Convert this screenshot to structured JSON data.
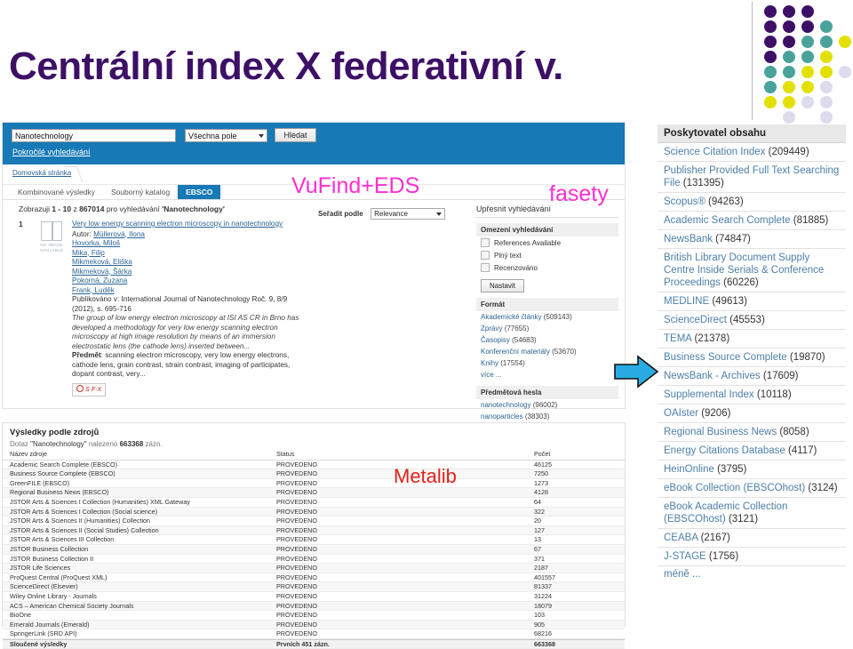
{
  "slide": {
    "title": "Centrální index X federativní v."
  },
  "decor": {
    "name": "dot-grid",
    "colors": {
      "purple": "#3d1066",
      "teal": "#49a39b",
      "yellow": "#e3e000",
      "lavender": "#dcdcec"
    },
    "rows": [
      [
        "purple",
        "purple",
        "purple",
        "",
        ""
      ],
      [
        "purple",
        "purple",
        "purple",
        "teal",
        ""
      ],
      [
        "purple",
        "purple",
        "teal",
        "teal",
        "yellow"
      ],
      [
        "purple",
        "teal",
        "teal",
        "yellow",
        ""
      ],
      [
        "teal",
        "teal",
        "yellow",
        "yellow",
        "lavender"
      ],
      [
        "teal",
        "yellow",
        "yellow",
        "lavender",
        ""
      ],
      [
        "yellow",
        "yellow",
        "lavender",
        "lavender",
        ""
      ],
      [
        "",
        "lavender",
        "",
        "lavender",
        ""
      ]
    ]
  },
  "annotations": {
    "vufind": "VuFind+EDS",
    "fasety": "fasety",
    "metalib": "Metalib",
    "arrow_color": "#29abe2",
    "pink": "#ff2fd0",
    "red": "#e32119"
  },
  "vufind": {
    "search": {
      "query_value": "Nanotechnology",
      "scope_value": "Všechna pole",
      "submit_label": "Hledat",
      "advanced_link": "Pokročilé vyhledávání"
    },
    "breadcrumb": "Domovská stránka",
    "tabs": [
      {
        "label": "Kombinované výsledky",
        "active": false
      },
      {
        "label": "Souborný katalog",
        "active": false
      },
      {
        "label": "EBSCO",
        "active": true
      }
    ],
    "results_summary": {
      "prefix": "Zobrazuji",
      "range": "1 - 10",
      "of": "z",
      "total": "867014",
      "suffix": "pro vyhledávání",
      "query": "'Nanotechnology'"
    },
    "sort": {
      "label": "Seřadit podle",
      "value": "Relevance"
    },
    "record": {
      "number": "1",
      "no_image": "NO IMAGE AVAILABLE",
      "title": "Very low energy scanning electron microscopy in nanotechnology",
      "author_label": "Autor:",
      "authors": [
        "Müllerová, Ilona",
        "Hovorka, Miloš",
        "Mika, Filip",
        "Mikmeková, Eliška",
        "Mikmeková, Šárka",
        "Pokorná, Zuzana",
        "Frank, Luděk"
      ],
      "published": "Publikováno v: International Journal of Nanotechnology Roč. 9, 8/9 (2012), s. 695-716",
      "abstract": "The group of low energy electron microscopy at ISI AS CR in Brno has developed a methodology for very low energy scanning electron microscopy at high image resolution by means of an immersion electrostatic lens (the cathode lens) inserted between...",
      "subject_label": "Předmět",
      "subject": ": scanning electron microscopy, very low energy electrons, cathode lens, grain contrast, strain contrast, imaging of participates, dopant contrast, very...",
      "sfx_label": "S·F·X"
    },
    "facets": {
      "title": "Upřesnit vyhledávání",
      "limit_group": {
        "header": "Omezení vyhledávání",
        "items": [
          "References Available",
          "Plný text",
          "Recenzováno"
        ],
        "button": "Nastavit"
      },
      "format_group": {
        "header": "Formát",
        "items": [
          {
            "label": "Akademické články",
            "count": "(509143)"
          },
          {
            "label": "Zprávy",
            "count": "(77655)"
          },
          {
            "label": "Časopisy",
            "count": "(54683)"
          },
          {
            "label": "Konferenční materiály",
            "count": "(53670)"
          },
          {
            "label": "Knihy",
            "count": "(17554)"
          }
        ],
        "more": "více ..."
      },
      "subject_group": {
        "header": "Předmětová hesla",
        "items": [
          {
            "label": "nanotechnology",
            "count": "(96002)"
          },
          {
            "label": "nanoparticles",
            "count": "(38303)"
          }
        ]
      }
    }
  },
  "provider_panel": {
    "header": "Poskytovatel obsahu",
    "items": [
      {
        "label": "Science Citation Index",
        "count": "(209449)"
      },
      {
        "label": "Publisher Provided Full Text Searching File",
        "count": "(131395)"
      },
      {
        "label": "Scopus®",
        "count": "(94263)"
      },
      {
        "label": "Academic Search Complete",
        "count": "(81885)"
      },
      {
        "label": "NewsBank",
        "count": "(74847)"
      },
      {
        "label": "British Library Document Supply Centre Inside Serials & Conference Proceedings",
        "count": "(60226)"
      },
      {
        "label": "MEDLINE",
        "count": "(49613)"
      },
      {
        "label": "ScienceDirect",
        "count": "(45553)"
      },
      {
        "label": "TEMA",
        "count": "(21378)"
      },
      {
        "label": "Business Source Complete",
        "count": "(19870)"
      },
      {
        "label": "NewsBank - Archives",
        "count": "(17609)"
      },
      {
        "label": "Supplemental Index",
        "count": "(10118)"
      },
      {
        "label": "OAIster",
        "count": "(9206)"
      },
      {
        "label": "Regional Business News",
        "count": "(8058)"
      },
      {
        "label": "Energy Citations Database",
        "count": "(4117)"
      },
      {
        "label": "HeinOnline",
        "count": "(3795)"
      },
      {
        "label": "eBook Collection (EBSCOhost)",
        "count": "(3124)"
      },
      {
        "label": "eBook Academic Collection (EBSCOhost)",
        "count": "(3121)"
      },
      {
        "label": "CEABA",
        "count": "(2167)"
      },
      {
        "label": "J-STAGE",
        "count": "(1756)"
      }
    ],
    "less": "méně ..."
  },
  "metalib": {
    "title": "Výsledky podle zdrojů",
    "subtitle_prefix": "Dotaz",
    "subtitle_query": "\"Nanotechnology\"",
    "subtitle_mid": "nalezeno",
    "subtitle_total": "663368",
    "subtitle_suffix": "zázn.",
    "columns": [
      "Název zdroje",
      "Status",
      "Počet"
    ],
    "rows": [
      {
        "source": "Academic Search Complete (EBSCO)",
        "status": "PROVEDENO",
        "count": "46125"
      },
      {
        "source": "Business Source Complete (EBSCO)",
        "status": "PROVEDENO",
        "count": "7250"
      },
      {
        "source": "GreenFILE (EBSCO)",
        "status": "PROVEDENO",
        "count": "1273"
      },
      {
        "source": "Regional Business News (EBSCO)",
        "status": "PROVEDENO",
        "count": "4128"
      },
      {
        "source": "JSTOR Arts & Sciences I Collection (Humanities) XML Gateway",
        "status": "PROVEDENO",
        "count": "64"
      },
      {
        "source": "JSTOR Arts & Sciences I Collection (Social science)",
        "status": "PROVEDENO",
        "count": "322"
      },
      {
        "source": "JSTOR Arts & Sciences II (Humanities) Collection",
        "status": "PROVEDENO",
        "count": "20"
      },
      {
        "source": "JSTOR Arts & Sciences II (Social Studies) Collection",
        "status": "PROVEDENO",
        "count": "127"
      },
      {
        "source": "JSTOR Arts & Sciences III Collection",
        "status": "PROVEDENO",
        "count": "13"
      },
      {
        "source": "JSTOR Business Collection",
        "status": "PROVEDENO",
        "count": "67"
      },
      {
        "source": "JSTOR Business Collection II",
        "status": "PROVEDENO",
        "count": "371"
      },
      {
        "source": "JSTOR Life Sciences",
        "status": "PROVEDENO",
        "count": "2187"
      },
      {
        "source": "ProQuest Central (ProQuest XML)",
        "status": "PROVEDENO",
        "count": "401557"
      },
      {
        "source": "ScienceDirect (Elsevier)",
        "status": "PROVEDENO",
        "count": "81337"
      },
      {
        "source": "Wiley Online Library - Journals",
        "status": "PROVEDENO",
        "count": "31224"
      },
      {
        "source": "ACS – American Chemical Society Journals",
        "status": "PROVEDENO",
        "count": "18079"
      },
      {
        "source": "BioOne",
        "status": "PROVEDENO",
        "count": "103"
      },
      {
        "source": "Emerald Journals (Emerald)",
        "status": "PROVEDENO",
        "count": "905"
      },
      {
        "source": "SpringerLink (SRD API)",
        "status": "PROVEDENO",
        "count": "68216"
      }
    ],
    "total_row": {
      "source": "Sloučené výsledky",
      "status": "Prvních 451 zázn.",
      "count": "663368"
    }
  }
}
